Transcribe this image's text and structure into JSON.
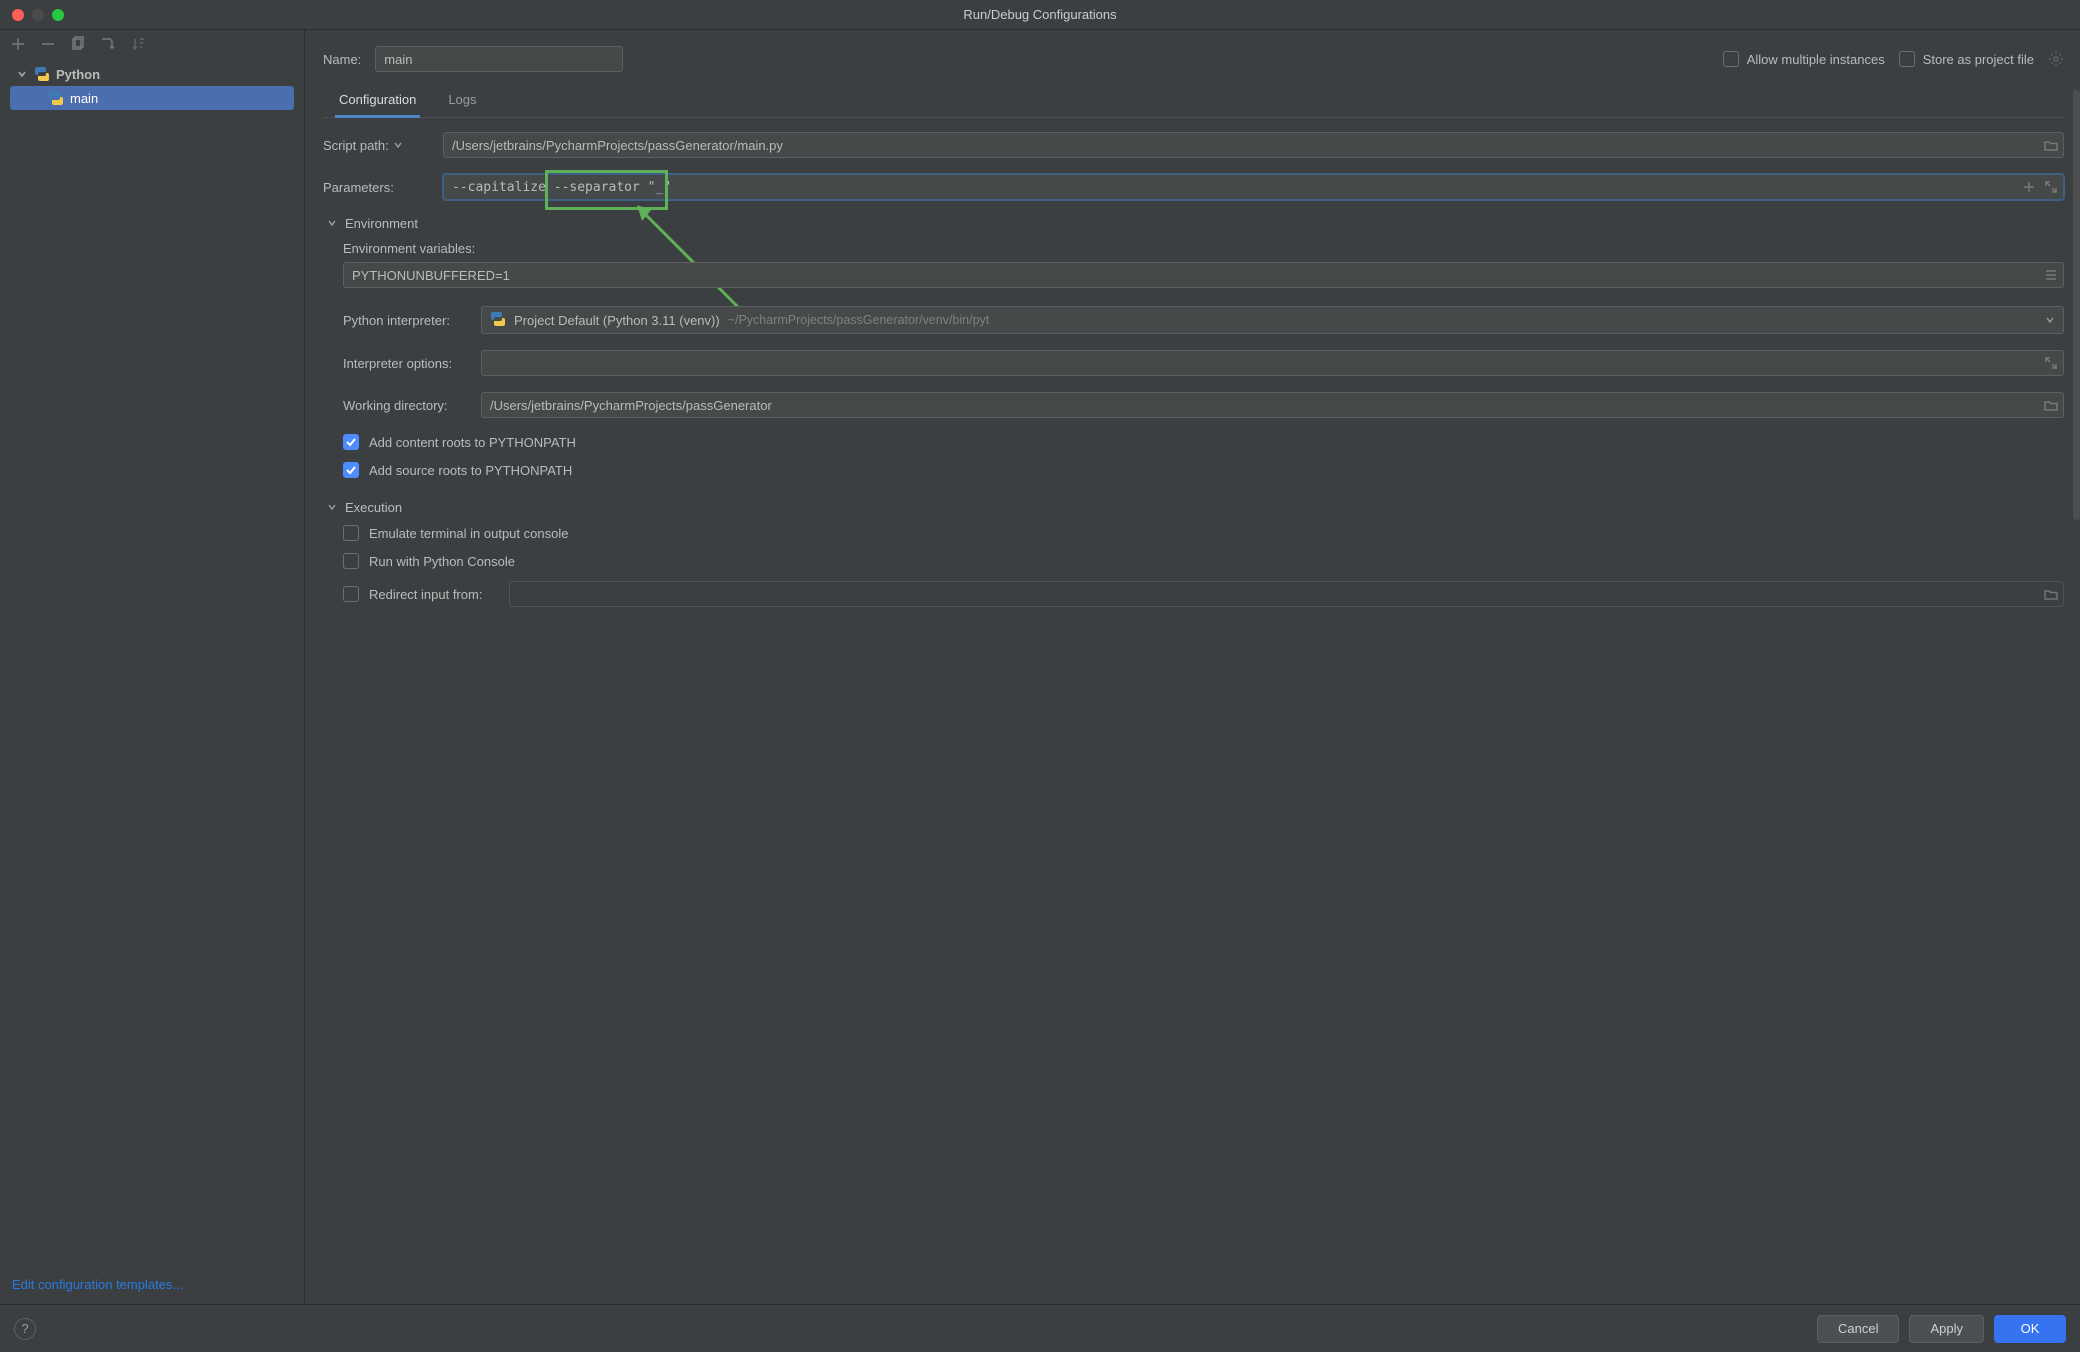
{
  "title": "Run/Debug Configurations",
  "sidebar": {
    "python_label": "Python",
    "items": [
      {
        "label": "main"
      }
    ],
    "edit_templates": "Edit configuration templates..."
  },
  "name": {
    "label": "Name:",
    "value": "main"
  },
  "allow_multiple_label": "Allow multiple instances",
  "store_as_project_label": "Store as project file",
  "tabs": {
    "configuration": "Configuration",
    "logs": "Logs"
  },
  "script_path": {
    "label": "Script path:",
    "value": "/Users/jetbrains/PycharmProjects/passGenerator/main.py"
  },
  "parameters": {
    "label": "Parameters:",
    "value": "--capitalize --separator \"_\""
  },
  "environment": {
    "heading": "Environment",
    "env_vars_label": "Environment variables:",
    "env_vars_value": "PYTHONUNBUFFERED=1",
    "interpreter_label": "Python interpreter:",
    "interpreter_value": "Project Default (Python 3.11 (venv))",
    "interpreter_hint": "~/PycharmProjects/passGenerator/venv/bin/pyt",
    "interpreter_options_label": "Interpreter options:",
    "working_dir_label": "Working directory:",
    "working_dir_value": "/Users/jetbrains/PycharmProjects/passGenerator",
    "content_roots_label": "Add content roots to PYTHONPATH",
    "source_roots_label": "Add source roots to PYTHONPATH"
  },
  "execution": {
    "heading": "Execution",
    "emulate_terminal_label": "Emulate terminal in output console",
    "python_console_label": "Run with Python Console",
    "redirect_input_label": "Redirect input from:"
  },
  "footer": {
    "cancel": "Cancel",
    "apply": "Apply",
    "ok": "OK"
  }
}
